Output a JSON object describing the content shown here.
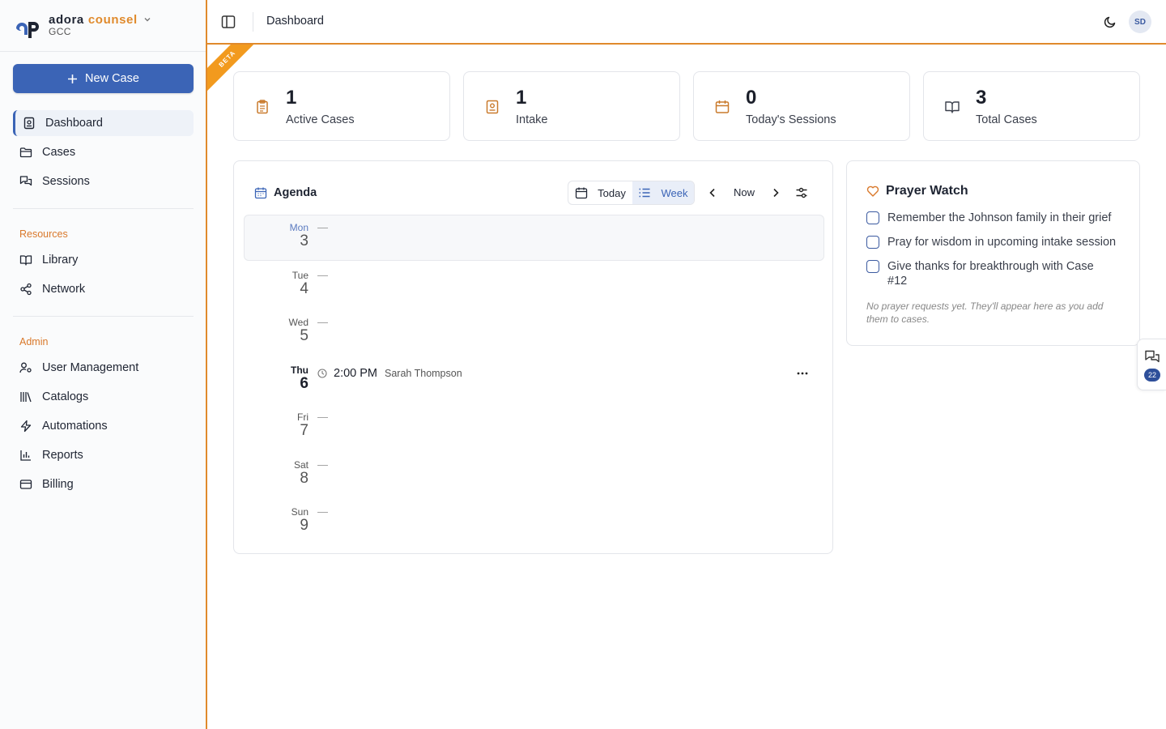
{
  "brand": {
    "name1": "adora",
    "name2": "counsel",
    "org": "GCC"
  },
  "sidebar": {
    "new_case_label": "New Case",
    "main_items": [
      {
        "label": "Dashboard",
        "icon": "dashboard-icon",
        "active": true
      },
      {
        "label": "Cases",
        "icon": "folder-icon"
      },
      {
        "label": "Sessions",
        "icon": "chat-icon"
      }
    ],
    "resources_heading": "Resources",
    "resources_items": [
      {
        "label": "Library",
        "icon": "book-open-icon"
      },
      {
        "label": "Network",
        "icon": "share-icon"
      }
    ],
    "admin_heading": "Admin",
    "admin_items": [
      {
        "label": "User Management",
        "icon": "user-key-icon"
      },
      {
        "label": "Catalogs",
        "icon": "library-icon"
      },
      {
        "label": "Automations",
        "icon": "zap-icon"
      },
      {
        "label": "Reports",
        "icon": "bar-chart-icon"
      },
      {
        "label": "Billing",
        "icon": "credit-card-icon"
      }
    ]
  },
  "header": {
    "title": "Dashboard",
    "avatar_initials": "SD",
    "beta_label": "BETA"
  },
  "stats": [
    {
      "value": "1",
      "label": "Active Cases",
      "icon": "clipboard-icon"
    },
    {
      "value": "1",
      "label": "Intake",
      "icon": "contact-book-icon"
    },
    {
      "value": "0",
      "label": "Today's Sessions",
      "icon": "calendar-icon"
    },
    {
      "value": "3",
      "label": "Total Cases",
      "icon": "book-icon"
    }
  ],
  "agenda": {
    "title": "Agenda",
    "today_label": "Today",
    "week_label": "Week",
    "now_label": "Now",
    "days": [
      {
        "name": "Mon",
        "num": "3",
        "dash": "—"
      },
      {
        "name": "Tue",
        "num": "4",
        "dash": "—"
      },
      {
        "name": "Wed",
        "num": "5",
        "dash": "—"
      },
      {
        "name": "Thu",
        "num": "6"
      },
      {
        "name": "Fri",
        "num": "7",
        "dash": "—"
      },
      {
        "name": "Sat",
        "num": "8",
        "dash": "—"
      },
      {
        "name": "Sun",
        "num": "9",
        "dash": "—"
      }
    ],
    "event": {
      "time": "2:00 PM",
      "name": "Sarah Thompson"
    }
  },
  "prayer": {
    "title": "Prayer Watch",
    "items": [
      "Remember the Johnson family in their grief",
      "Pray for wisdom in upcoming intake session",
      "Give thanks for breakthrough with Case #12"
    ],
    "empty_text": "No prayer requests yet. They'll appear here as you add them to cases."
  },
  "chat": {
    "badge": "22"
  },
  "colors": {
    "accent": "#3b64b6",
    "orange": "#e08a2c",
    "beta": "#f29a1e"
  }
}
